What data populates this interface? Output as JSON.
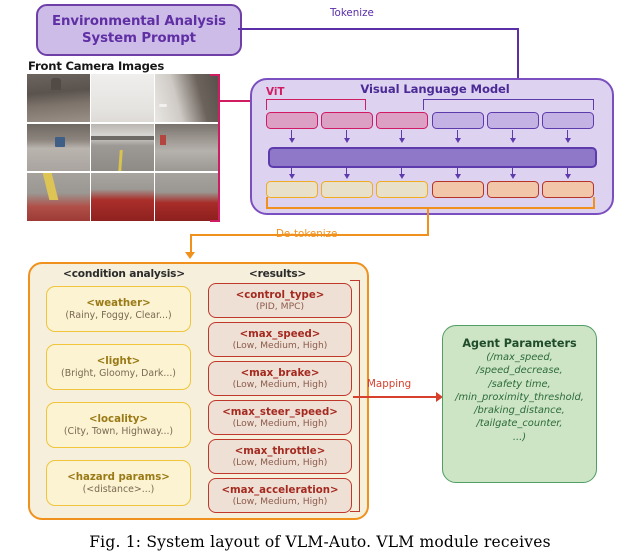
{
  "prompt": {
    "label": "Environmental Analysis\nSystem Prompt"
  },
  "camera": {
    "title": "Front Camera Images"
  },
  "vlm": {
    "title": "Visual Language Model",
    "vit_label": "ViT",
    "image_tokens": [
      "",
      "",
      ""
    ],
    "text_tokens": [
      "",
      "",
      ""
    ],
    "output_tokens_left": [
      "",
      "",
      ""
    ],
    "output_tokens_right": [
      "",
      "",
      ""
    ]
  },
  "arrows": {
    "tokenize": "Tokenize",
    "detokenize": "De-tokenize",
    "mapping": "Mapping"
  },
  "analysis": {
    "condition_title": "<condition analysis>",
    "results_title": "<results>",
    "conditions": [
      {
        "name": "<weather>",
        "values": "(Rainy, Foggy, Clear...)"
      },
      {
        "name": "<light>",
        "values": "(Bright, Gloomy, Dark...)"
      },
      {
        "name": "<locality>",
        "values": "(City, Town, Highway...)"
      },
      {
        "name": "<hazard params>",
        "values": "(<distance>...)"
      }
    ],
    "results": [
      {
        "name": "<control_type>",
        "values": "(PID, MPC)"
      },
      {
        "name": "<max_speed>",
        "values": "(Low, Medium, High)"
      },
      {
        "name": "<max_brake>",
        "values": "(Low, Medium, High)"
      },
      {
        "name": "<max_steer_speed>",
        "values": "(Low, Medium, High)"
      },
      {
        "name": "<max_throttle>",
        "values": "(Low, Medium, High)"
      },
      {
        "name": "<max_acceleration>",
        "values": "(Low, Medium, High)"
      }
    ]
  },
  "agent": {
    "title": "Agent Parameters",
    "params": "(/max_speed,\n/speed_decrease,\n/safety time,\n/min_proximity_threshold,\n/braking_distance,\n/tailgate_counter,\n...)"
  },
  "caption": {
    "text": "Fig. 1: System layout of VLM-Auto. VLM module receives"
  },
  "colors": {
    "purple": "#6f3fa8",
    "purple_fill": "#cdbce8",
    "crimson": "#cf1c63",
    "orange": "#f0911e",
    "red": "#c0372b",
    "green": "#4f9e63",
    "gold": "#f0c53c"
  }
}
